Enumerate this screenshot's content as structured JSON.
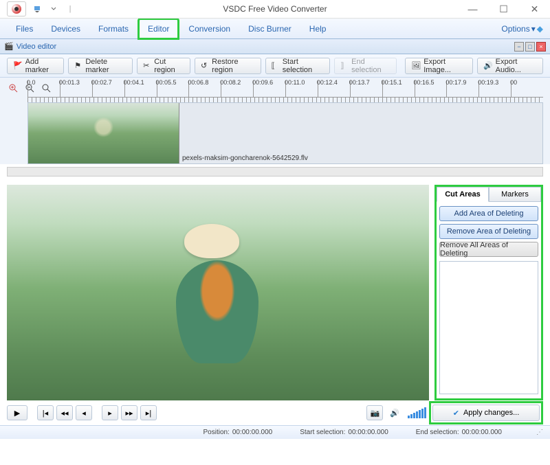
{
  "window": {
    "title": "VSDC Free Video Converter"
  },
  "menu": {
    "tabs": [
      "Files",
      "Devices",
      "Formats",
      "Editor",
      "Conversion",
      "Disc Burner",
      "Help"
    ],
    "highlighted_index": 3,
    "options_label": "Options"
  },
  "subwindow": {
    "title": "Video editor"
  },
  "toolbar": {
    "add_marker": "Add marker",
    "delete_marker": "Delete marker",
    "cut_region": "Cut region",
    "restore_region": "Restore region",
    "start_selection": "Start selection",
    "end_selection": "End selection",
    "export_image": "Export Image...",
    "export_audio": "Export Audio..."
  },
  "timeline": {
    "ticks": [
      "0.0",
      "00:01.3",
      "00:02.7",
      "00:04.1",
      "00:05.5",
      "00:06.8",
      "00:08.2",
      "00:09.6",
      "00:11.0",
      "00:12.4",
      "00:13.7",
      "00:15.1",
      "00:16.5",
      "00:17.9",
      "00:19.3",
      "00"
    ],
    "clip_filename": "pexels-maksim-goncharenok-5642529.flv"
  },
  "sidepanel": {
    "tabs": {
      "cut_areas": "Cut Areas",
      "markers": "Markers"
    },
    "add_area": "Add Area of Deleting",
    "remove_area": "Remove Area of Deleting",
    "remove_all": "Remove All Areas of Deleting"
  },
  "apply": {
    "label": "Apply changes..."
  },
  "status": {
    "position_label": "Position:",
    "position_value": "00:00:00.000",
    "start_label": "Start selection:",
    "start_value": "00:00:00.000",
    "end_label": "End selection:",
    "end_value": "00:00:00.000"
  }
}
